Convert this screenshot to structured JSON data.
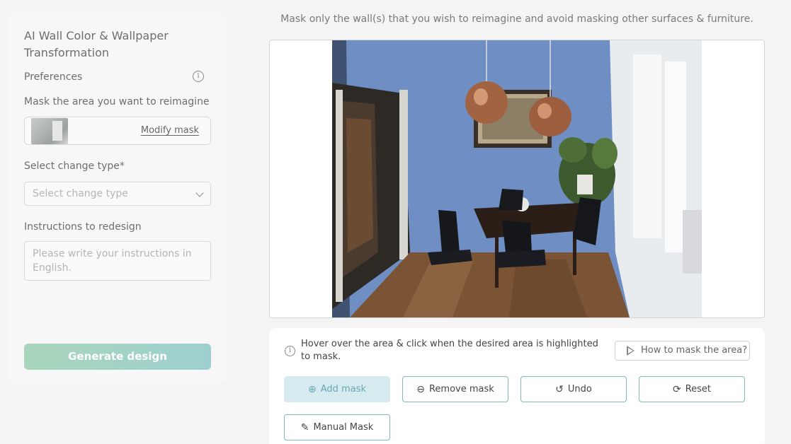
{
  "panel": {
    "title": "AI Wall Color & Wallpaper Transformation",
    "preferences_label": "Preferences",
    "mask_label": "Mask the area you want to reimagine",
    "modify_mask": "Modify mask",
    "change_type_label": "Select change type*",
    "change_type_placeholder": "Select change type",
    "instructions_label": "Instructions to redesign",
    "instructions_placeholder": "Please write your instructions in English.",
    "generate_button": "Generate design"
  },
  "header": {
    "hint": "Mask only the wall(s) that you wish to reimagine and avoid masking other surfaces & furniture."
  },
  "toolbar": {
    "hover_hint": "Hover over the area & click when the desired area is highlighted to mask.",
    "how_to": "How to mask the area?",
    "add_mask": "Add mask",
    "remove_mask": "Remove mask",
    "undo": "Undo",
    "reset": "Reset",
    "manual_mask": "Manual Mask"
  },
  "colors": {
    "wall_blue": "#6f8fc4",
    "accent_teal": "#7fb8bd",
    "generate_gradient_start": "#a9d6bb",
    "generate_gradient_end": "#9dcfcf"
  },
  "icons": {
    "info": "info-icon",
    "play": "play-icon",
    "add": "plus-circle-icon",
    "remove": "minus-circle-icon",
    "undo": "undo-icon",
    "reset": "refresh-icon",
    "manual": "brush-icon",
    "chevron": "chevron-down-icon"
  }
}
